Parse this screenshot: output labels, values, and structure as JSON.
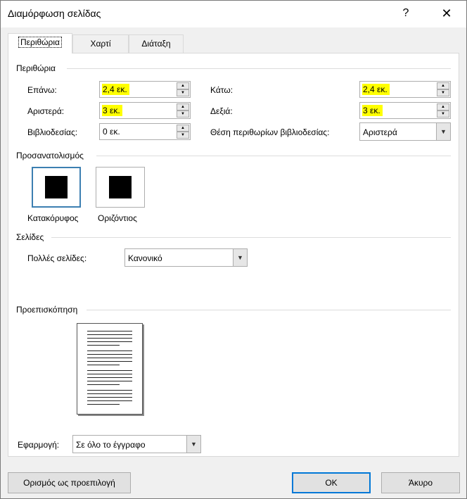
{
  "window": {
    "title": "Διαμόρφωση σελίδας",
    "help": "?",
    "close": "✕"
  },
  "tabs": [
    {
      "label": "Περιθώρια",
      "active": true
    },
    {
      "label": "Χαρτί",
      "active": false
    },
    {
      "label": "Διάταξη",
      "active": false
    }
  ],
  "margins": {
    "section_label": "Περιθώρια",
    "top": {
      "label": "Επάνω:",
      "value": "2,4 εκ."
    },
    "bottom": {
      "label": "Κάτω:",
      "value": "2,4 εκ."
    },
    "left": {
      "label": "Αριστερά:",
      "value": "3 εκ."
    },
    "right": {
      "label": "Δεξιά:",
      "value": "3 εκ."
    },
    "gutter": {
      "label": "Βιβλιοδεσίας:",
      "value": "0 εκ."
    },
    "gutter_position": {
      "label": "Θέση περιθωρίων βιβλιοδεσίας:",
      "value": "Αριστερά"
    }
  },
  "orientation": {
    "section_label": "Προσανατολισμός",
    "portrait_label": "Κατακόρυφος",
    "landscape_label": "Οριζόντιος",
    "selected": "portrait"
  },
  "pages": {
    "section_label": "Σελίδες",
    "multiple_pages_label": "Πολλές σελίδες:",
    "multiple_pages_value": "Κανονικό"
  },
  "preview": {
    "section_label": "Προεπισκόπηση"
  },
  "apply_to": {
    "label": "Εφαρμογή:",
    "value": "Σε όλο το έγγραφο"
  },
  "buttons": {
    "set_default": "Ορισμός ως προεπιλογή",
    "ok": "OK",
    "cancel": "Άκυρο"
  },
  "colors": {
    "highlight": "#ffff00",
    "accent": "#0078d7"
  }
}
